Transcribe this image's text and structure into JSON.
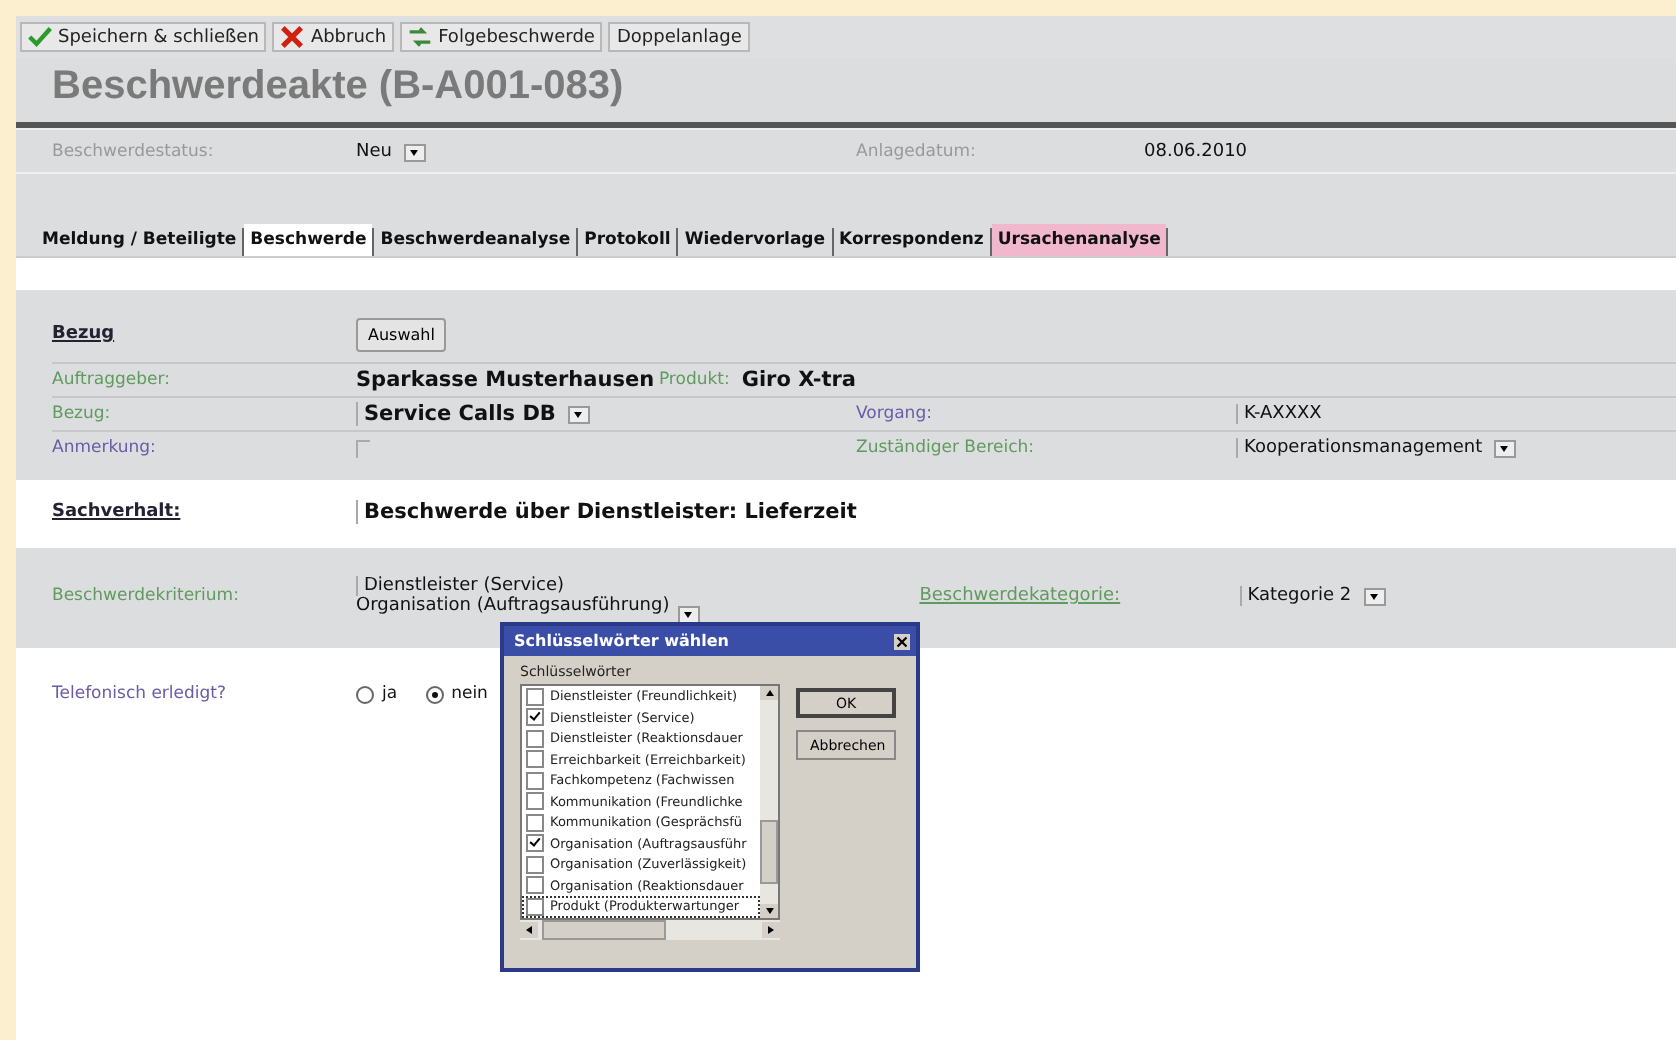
{
  "toolbar": [
    {
      "label": "Speichern & schließen"
    },
    {
      "label": "Abbruch"
    },
    {
      "label": "Folgebeschwerde"
    },
    {
      "label": "Doppelanlage"
    }
  ],
  "title": "Beschwerdeakte (B-A001-083)",
  "status": {
    "label": "Beschwerdestatus:",
    "value": "Neu",
    "date_label": "Anlagedatum:",
    "date": "08.06.2010"
  },
  "tabs": [
    {
      "label": "Meldung / Beteiligte",
      "selected": false,
      "highlighted": false
    },
    {
      "label": "Beschwerde",
      "selected": true,
      "highlighted": false
    },
    {
      "label": "Beschwerdeanalyse",
      "selected": false,
      "highlighted": false
    },
    {
      "label": "Protokoll",
      "selected": false,
      "highlighted": false
    },
    {
      "label": "Wiedervorlage",
      "selected": false,
      "highlighted": false
    },
    {
      "label": "Korrespondenz",
      "selected": false,
      "highlighted": false
    },
    {
      "label": "Ursachenanalyse",
      "selected": false,
      "highlighted": true
    }
  ],
  "bezug": {
    "heading": "Bezug",
    "button": "Auswahl",
    "rows": [
      {
        "left": {
          "label": "Auftraggeber:",
          "color": "#5f9a5f",
          "value": "Sparkasse Musterhausen",
          "kind": "text"
        },
        "right": {
          "label": "Produkt:",
          "color": "#5f9a5f",
          "value": "Giro X-tra",
          "kind": "inline"
        }
      },
      {
        "left": {
          "label": "Bezug:",
          "color": "#5f9a5f",
          "value": "Service Calls DB",
          "kind": "dropdown"
        },
        "right": {
          "label": "Vorgang:",
          "color": "#6a5aa8",
          "value": "K-AXXXX",
          "kind": "input"
        }
      },
      {
        "left": {
          "label": "Anmerkung:",
          "color": "#6a5aa8",
          "kind": "input"
        },
        "right": {
          "label": "Zuständiger Bereich:",
          "color": "#5f9a5f",
          "value": "Kooperationsmanagement",
          "kind": "dropdown"
        }
      }
    ]
  },
  "sachverhalt": {
    "label": "Sachverhalt:",
    "value": "Beschwerde über Dienstleister: Lieferzeit"
  },
  "kriterium": {
    "label": "Beschwerdekriterium:",
    "values": [
      "Dienstleister (Service)",
      "Organisation (Auftragsausführung)"
    ],
    "category_label": "Beschwerdekategorie:",
    "category": "Kategorie 2"
  },
  "telefonisch": {
    "label": "Telefonisch erledigt?",
    "options": [
      {
        "label": "ja",
        "selected": false
      },
      {
        "label": "nein",
        "selected": true
      }
    ]
  },
  "dialog": {
    "title": "Schlüsselwörter wählen",
    "list_label": "Schlüsselwörter",
    "buttons": [
      "OK",
      "Abbrechen"
    ],
    "items": [
      {
        "label": "Dienstleister (Freundlichkeit)",
        "checked": false
      },
      {
        "label": "Dienstleister (Service)",
        "checked": true
      },
      {
        "label": "Dienstleister (Reaktionsdauer",
        "checked": false
      },
      {
        "label": "Erreichbarkeit (Erreichbarkeit)",
        "checked": false
      },
      {
        "label": "Fachkompetenz (Fachwissen",
        "checked": false
      },
      {
        "label": "Kommunikation (Freundlichke",
        "checked": false
      },
      {
        "label": "Kommunikation (Gesprächsfü",
        "checked": false
      },
      {
        "label": "Organisation (Auftragsausführ",
        "checked": true
      },
      {
        "label": "Organisation (Zuverlässigkeit)",
        "checked": false
      },
      {
        "label": "Organisation (Reaktionsdauer",
        "checked": false
      },
      {
        "label": "Produkt (Produkterwartunger",
        "checked": false
      }
    ]
  }
}
